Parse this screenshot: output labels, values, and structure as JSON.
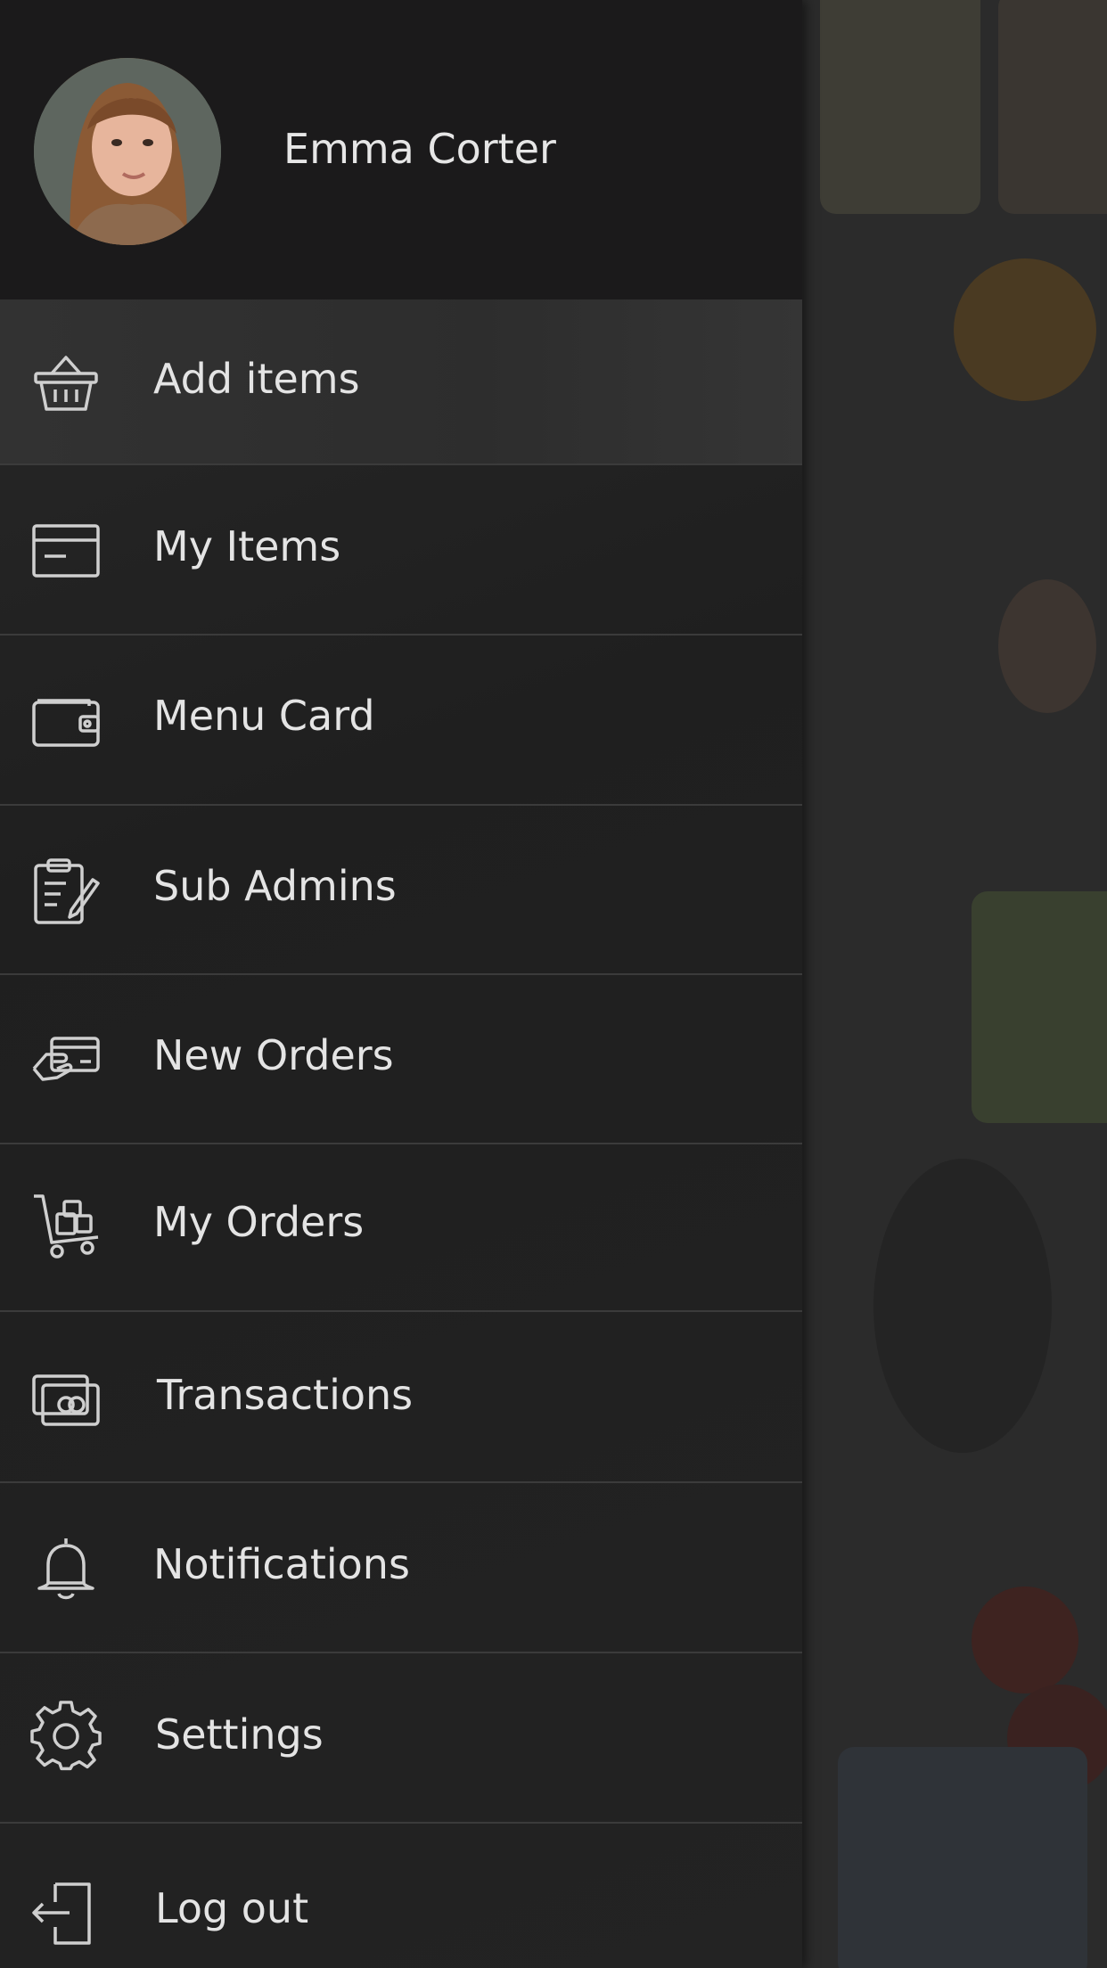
{
  "profile": {
    "name": "Emma Corter"
  },
  "menu": {
    "items": [
      {
        "label": "Add items",
        "icon": "basket-icon"
      },
      {
        "label": "My Items",
        "icon": "card-icon"
      },
      {
        "label": "Menu Card",
        "icon": "wallet-icon"
      },
      {
        "label": "Sub Admins",
        "icon": "clipboard-edit-icon"
      },
      {
        "label": "New Orders",
        "icon": "card-payment-icon"
      },
      {
        "label": "My Orders",
        "icon": "cart-trolley-icon"
      },
      {
        "label": "Transactions",
        "icon": "cash-icon"
      },
      {
        "label": "Notifications",
        "icon": "bell-icon"
      },
      {
        "label": "Settings",
        "icon": "gear-icon"
      },
      {
        "label": "Log out",
        "icon": "logout-icon"
      }
    ]
  },
  "colors": {
    "drawer_bg": "#1f1f1f",
    "text": "#e4e4e4",
    "divider": "#3b3b3b"
  }
}
